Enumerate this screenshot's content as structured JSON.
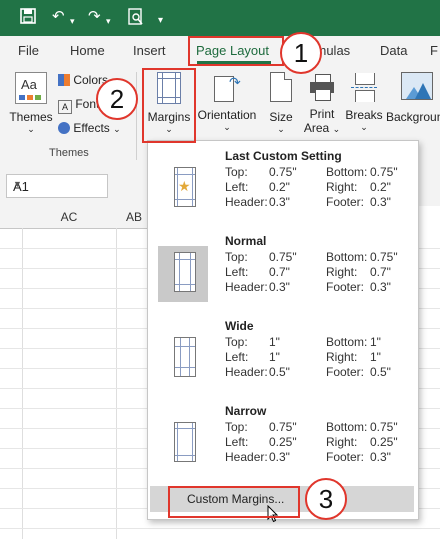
{
  "quick_access": {
    "icons": [
      "save-icon",
      "undo-icon",
      "redo-icon",
      "print-preview-icon"
    ]
  },
  "tabs": [
    "File",
    "Home",
    "Insert",
    "Page Layout",
    "Formulas",
    "Data",
    "F"
  ],
  "ribbon": {
    "themes_label": "Themes",
    "colors_label": "Colors",
    "fonts_label": "Fonts",
    "effects_label": "Effects",
    "group_themes": "Themes",
    "margins_label": "Margins",
    "orientation_label": "Orientation",
    "size_label": "Size",
    "print_area_line1": "Print",
    "print_area_line2": "Area",
    "breaks_label": "Breaks",
    "background_label": "Backgroun"
  },
  "namebox": {
    "value": "A1"
  },
  "columns": [
    "AC",
    "AB"
  ],
  "margins_menu": {
    "options": [
      {
        "title": "Last Custom Setting",
        "top_label": "Top:",
        "top": "0.75\"",
        "bottom_label": "Bottom:",
        "bottom": "0.75\"",
        "left_label": "Left:",
        "left": "0.2\"",
        "right_label": "Right:",
        "right": "0.2\"",
        "header_label": "Header:",
        "header": "0.3\"",
        "footer_label": "Footer:",
        "footer": "0.3\""
      },
      {
        "title": "Normal",
        "top_label": "Top:",
        "top": "0.75\"",
        "bottom_label": "Bottom:",
        "bottom": "0.75\"",
        "left_label": "Left:",
        "left": "0.7\"",
        "right_label": "Right:",
        "right": "0.7\"",
        "header_label": "Header:",
        "header": "0.3\"",
        "footer_label": "Footer:",
        "footer": "0.3\""
      },
      {
        "title": "Wide",
        "top_label": "Top:",
        "top": "1\"",
        "bottom_label": "Bottom:",
        "bottom": "1\"",
        "left_label": "Left:",
        "left": "1\"",
        "right_label": "Right:",
        "right": "1\"",
        "header_label": "Header:",
        "header": "0.5\"",
        "footer_label": "Footer:",
        "footer": "0.5\""
      },
      {
        "title": "Narrow",
        "top_label": "Top:",
        "top": "0.75\"",
        "bottom_label": "Bottom:",
        "bottom": "0.75\"",
        "left_label": "Left:",
        "left": "0.25\"",
        "right_label": "Right:",
        "right": "0.25\"",
        "header_label": "Header:",
        "header": "0.3\"",
        "footer_label": "Footer:",
        "footer": "0.3\""
      }
    ],
    "custom_label": "Custom Margins..."
  },
  "annotations": {
    "step1": "1",
    "step2": "2",
    "step3": "3"
  },
  "colors": {
    "excel_green": "#217346",
    "annotation_red": "#e0362c"
  }
}
